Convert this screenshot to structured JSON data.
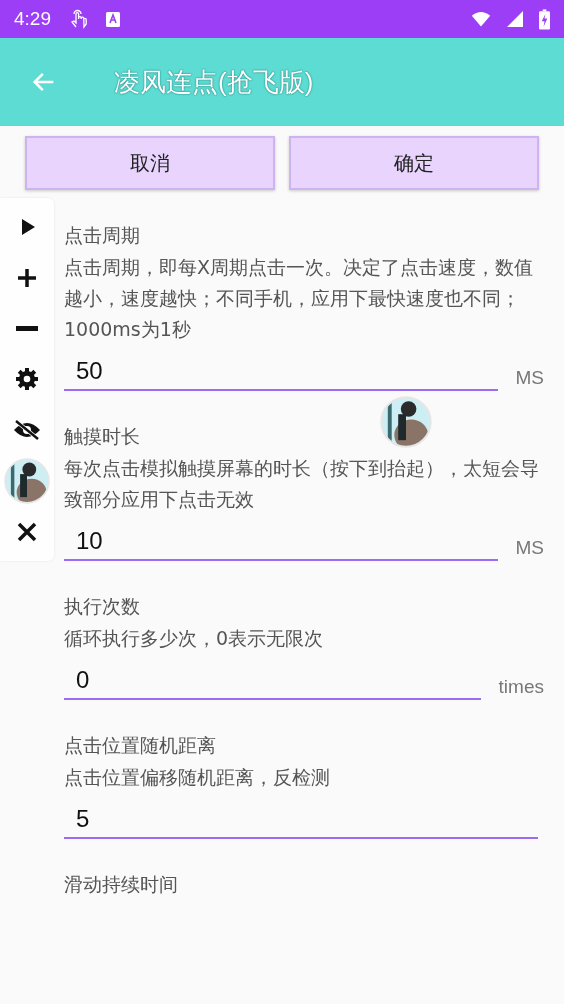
{
  "status_bar": {
    "time": "4:29"
  },
  "app_bar": {
    "title": "凌风连点(抢飞版)"
  },
  "buttons": [
    "取消",
    "确定"
  ],
  "settings": [
    {
      "label": "点击周期",
      "description": "点击周期，即每X周期点击一次。决定了点击速度，数值越小，速度越快；不同手机，应用下最快速度也不同；1000ms为1秒",
      "value": "50",
      "unit": "MS"
    },
    {
      "label": "触摸时长",
      "description": "每次点击模拟触摸屏幕的时长（按下到抬起），太短会导致部分应用下点击无效",
      "value": "10",
      "unit": "MS"
    },
    {
      "label": "执行次数",
      "description": "循环执行多少次，0表示无限次",
      "value": "0",
      "unit": "times"
    },
    {
      "label": "点击位置随机距离",
      "description": "点击位置偏移随机距离，反检测",
      "value": "5"
    },
    {
      "label": "滑动持续时间"
    }
  ],
  "floating_toolbar": {
    "items": [
      {
        "kind": "play"
      },
      {
        "kind": "plus"
      },
      {
        "kind": "minus"
      },
      {
        "kind": "gear"
      },
      {
        "kind": "hide"
      },
      {
        "kind": "picture"
      },
      {
        "kind": "close"
      }
    ]
  },
  "click_marker": {
    "kind": "picture"
  }
}
